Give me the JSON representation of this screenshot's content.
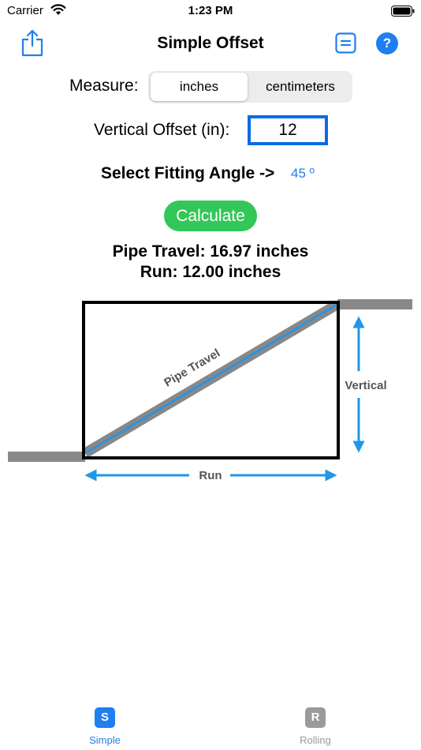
{
  "status": {
    "carrier": "Carrier",
    "time": "1:23 PM"
  },
  "nav": {
    "title": "Simple Offset"
  },
  "measure": {
    "label": "Measure:",
    "options": [
      "inches",
      "centimeters"
    ],
    "selected": "inches"
  },
  "offset": {
    "label": "Vertical Offset (in):",
    "value": "12"
  },
  "angle": {
    "label": "Select Fitting Angle ->",
    "value": "45 º"
  },
  "calculate_label": "Calculate",
  "results": {
    "travel": "Pipe Travel: 16.97 inches",
    "run": "Run: 12.00 inches"
  },
  "diagram": {
    "pipe_label": "Pipe Travel",
    "vertical_label": "Vertical",
    "run_label": "Run"
  },
  "tabs": [
    {
      "icon_letter": "S",
      "label": "Simple",
      "active": true
    },
    {
      "icon_letter": "R",
      "label": "Rolling",
      "active": false
    }
  ],
  "colors": {
    "accent": "#1f7ff0",
    "calculate": "#33c759",
    "pipe": "#888888"
  }
}
